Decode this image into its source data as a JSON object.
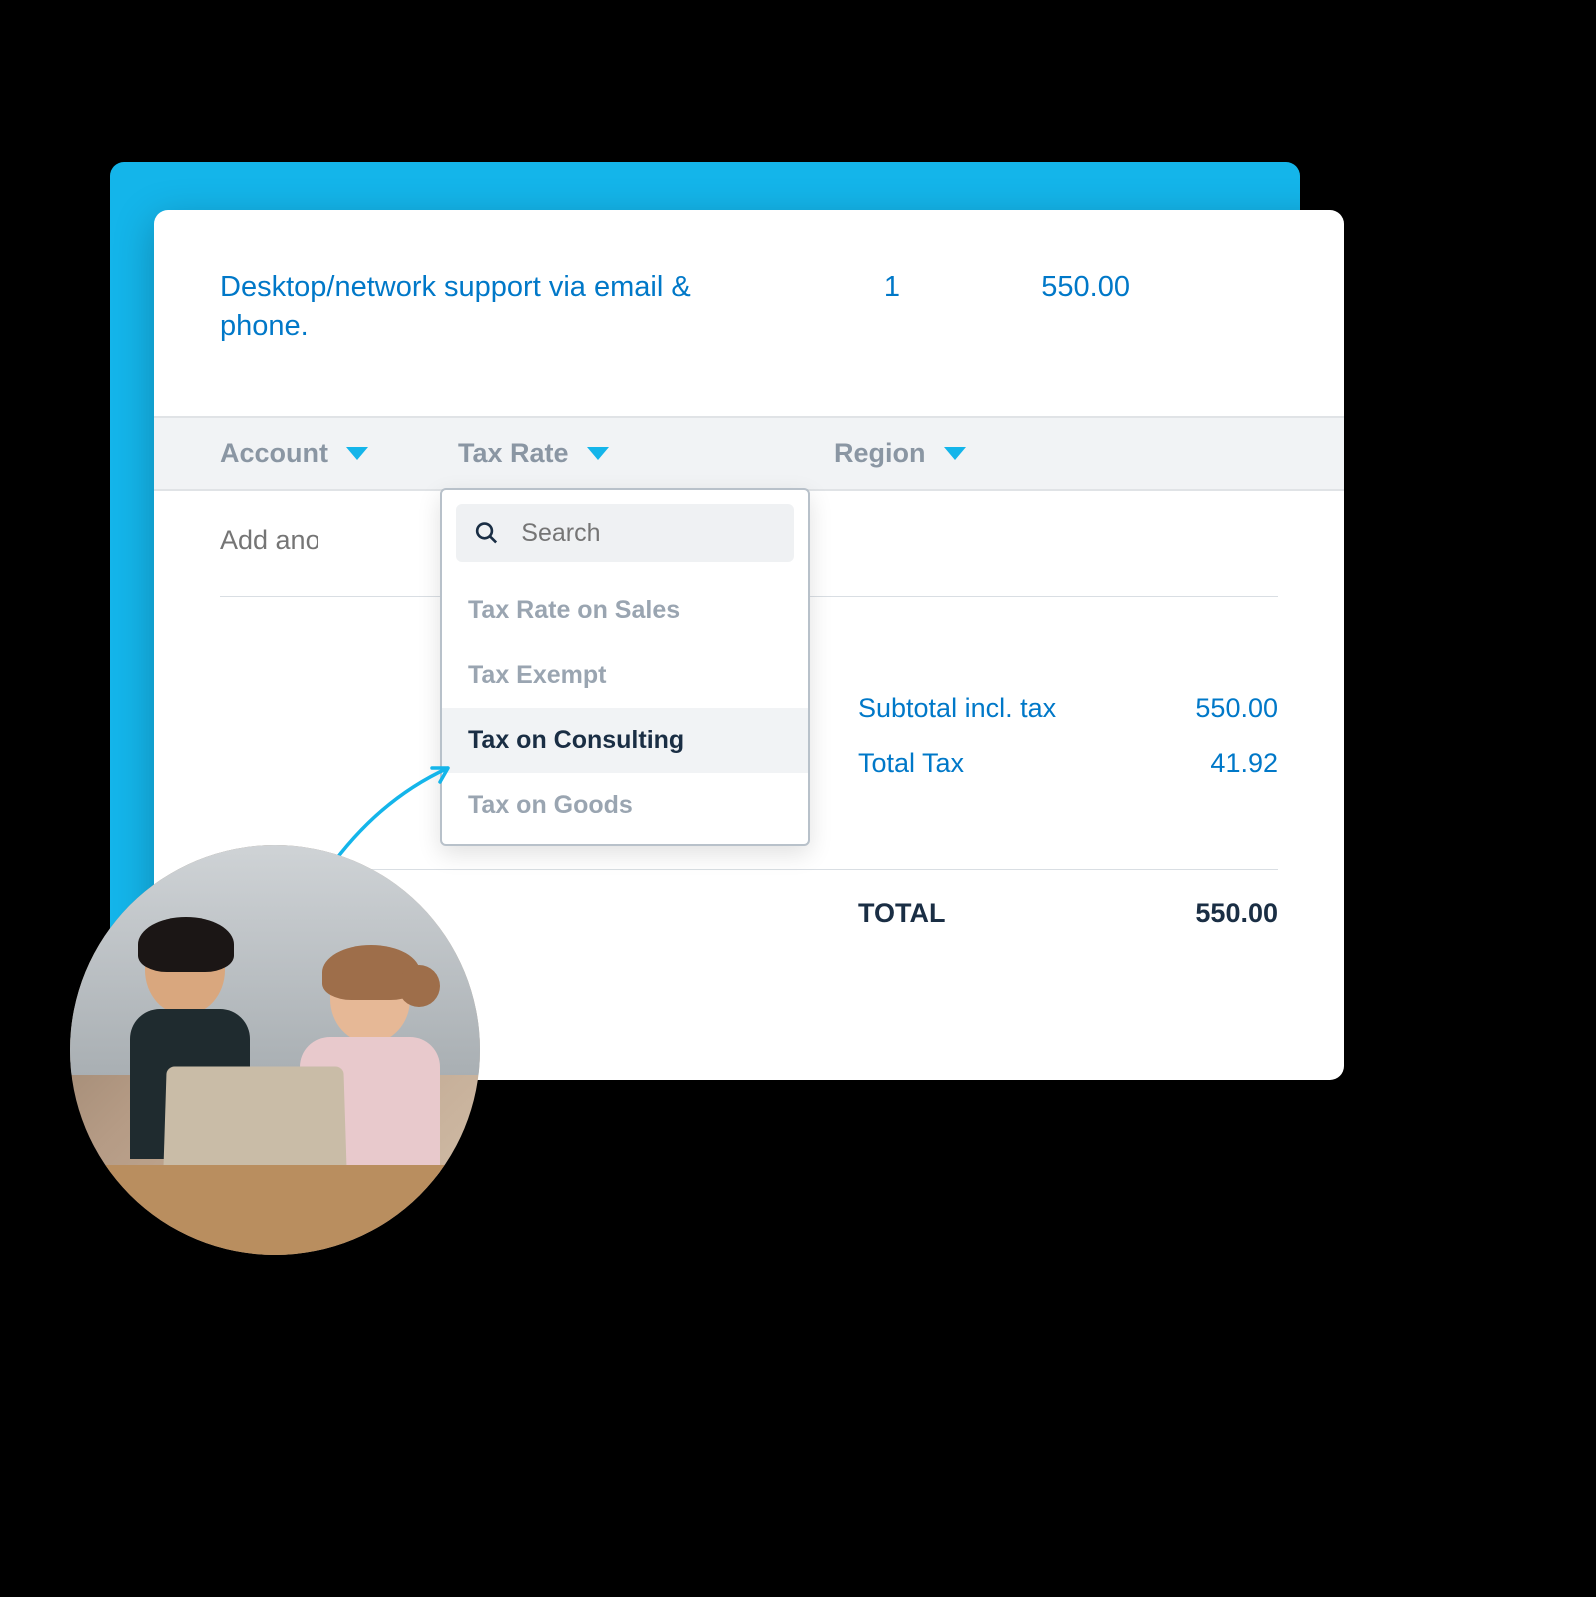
{
  "line": {
    "description": "Desktop/network support via email & phone.",
    "qty": "1",
    "amount": "550.00"
  },
  "columns": {
    "account": "Account",
    "tax_rate": "Tax Rate",
    "region": "Region"
  },
  "add_item_placeholder": "Add another item...",
  "dropdown": {
    "search_placeholder": "Search",
    "options": {
      "opt0": "Tax Rate on Sales",
      "opt1": "Tax Exempt",
      "opt2": "Tax on Consulting",
      "opt3": "Tax on Goods"
    }
  },
  "totals": {
    "subtotal_label": "Subtotal incl. tax",
    "subtotal_value": "550.00",
    "tax_label": "Total Tax",
    "tax_value": "41.92",
    "total_label": "TOTAL",
    "total_value": "550.00"
  }
}
